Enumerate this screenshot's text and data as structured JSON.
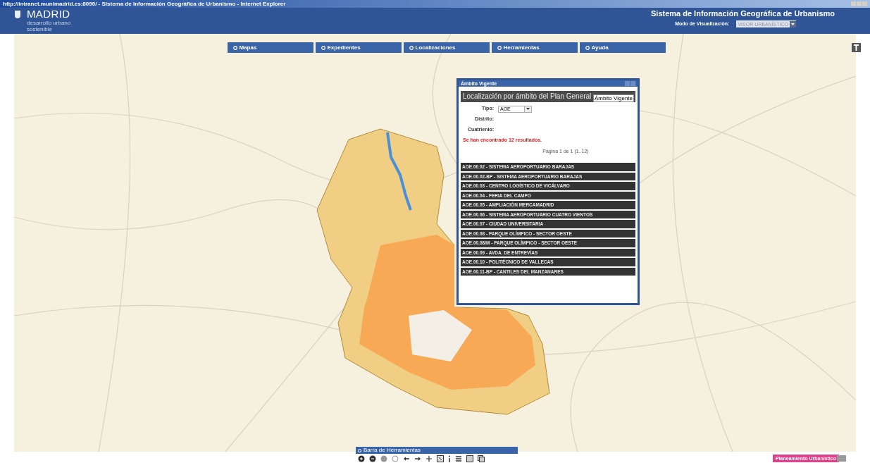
{
  "window": {
    "title": "http://intranet.munimadrid.es:8090/ - Sistema de Información Geográfica de Urbanismo - Internet Explorer"
  },
  "header": {
    "logo_text": "MADRID",
    "logo_subtitle": "desarrollo urbano sostenible",
    "app_title": "Sistema de Información Geográfica de Urbanismo",
    "mode_label": "Modo de Visualización:",
    "mode_value": "VISOR URBANÍSTICO"
  },
  "menu": [
    {
      "label": "Mapas"
    },
    {
      "label": "Expedientes"
    },
    {
      "label": "Localizaciones"
    },
    {
      "label": "Herramientas"
    },
    {
      "label": "Ayuda"
    }
  ],
  "dialog": {
    "title": "Ámbito Vigente",
    "heading": "Localización por ámbito del Plan General",
    "tooltip": "Ámbito Vigente",
    "fields": [
      {
        "label": "Tipo:",
        "value": "AOE",
        "kind": "select"
      },
      {
        "label": "Distrito:",
        "kind": "text"
      },
      {
        "label": "Cuatrienio:",
        "kind": "text"
      }
    ],
    "message": "Se han encontrado 12 resultados.",
    "pagination": "Página 1 de 1 (1..12)",
    "results": [
      "AOE.00.02 - SISTEMA AEROPORTUARIO BARAJAS",
      "AOE.00.02-BP - SISTEMA AEROPORTUARIO BARAJAS",
      "AOE.00.03 - CENTRO LOGÍSTICO DE VICÁLVARO",
      "AOE.00.04 - FERIA DEL CAMPO",
      "AOE.00.05 - AMPLIACIÓN MERCAMADRID",
      "AOE.00.06 - SISTEMA AEROPORTUARIO CUATRO VIENTOS",
      "AOE.00.07 - CIUDAD UNIVERSITARIA",
      "AOE.00.08 - PARQUE OLÍMPICO - SECTOR OESTE",
      "AOE.00.08/M - PARQUE OLÍMPICO - SECTOR OESTE",
      "AOE.00.09 - AVDA. DE ENTREVÍAS",
      "AOE.00.10 - POLITÉCNICO DE VALLECAS",
      "AOE.00.11-BP - CANTILES DEL MANZANARES"
    ]
  },
  "toolbar": {
    "title": "Barra de Herramientas"
  },
  "footer_button": "Planeamiento Urbanístico"
}
